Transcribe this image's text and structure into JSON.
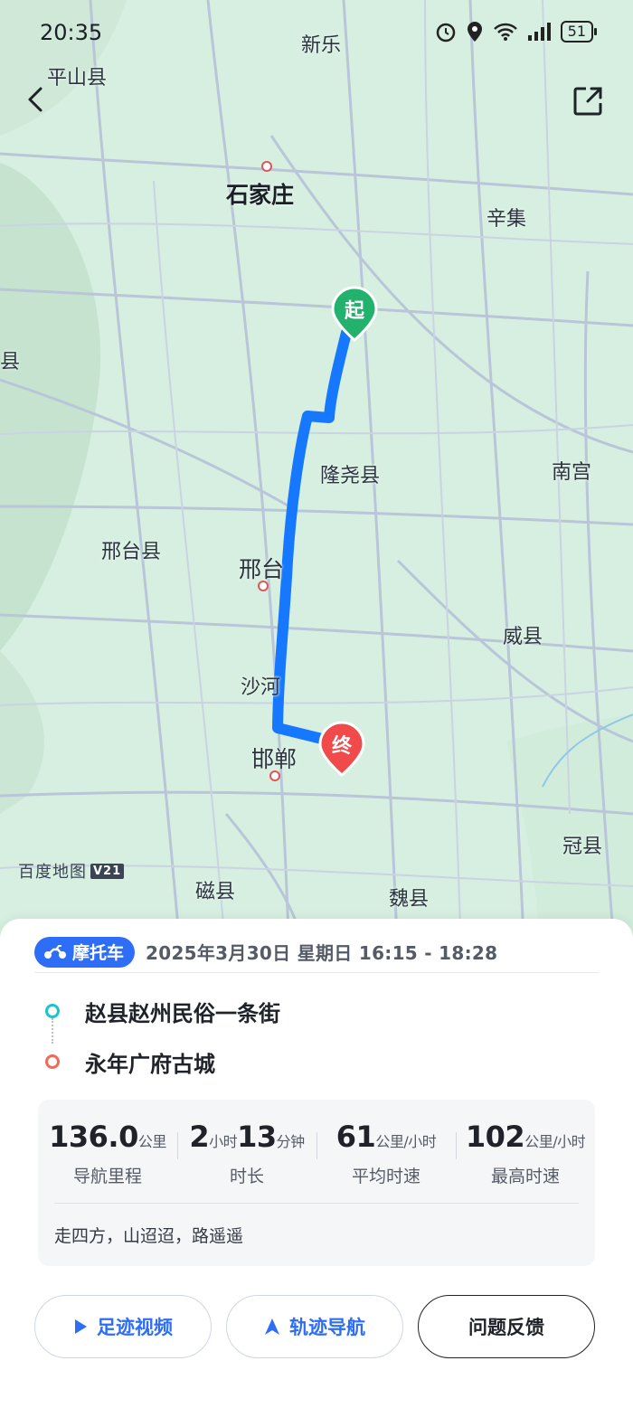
{
  "status_bar": {
    "time": "20:35",
    "battery": "51"
  },
  "map": {
    "labels": {
      "xinle": "新乐",
      "pingshan": "平山县",
      "shijiazhuang": "石家庄",
      "xinji": "辛集",
      "zhaoxian_partial": "赵县",
      "left_xian": "县",
      "longyao": "隆尧县",
      "nangong": "南宫",
      "xingtaixian": "邢台县",
      "xingtai": "邢台",
      "weixian": "威县",
      "shahe": "沙河",
      "handan": "邯郸",
      "guanxian": "冠县",
      "cixian": "磁县",
      "weixian2": "魏县",
      "left_edge": "县"
    },
    "start_marker": "起",
    "end_marker": "终",
    "logo": "百度地图",
    "logo_version": "V21"
  },
  "trip": {
    "mode": "摩托车",
    "datetime": "2025年3月30日 星期日 16:15 - 18:28",
    "start": "赵县赵州民俗一条街",
    "end": "永年广府古城"
  },
  "stats": {
    "distance_value": "136.0",
    "distance_unit": "公里",
    "distance_label": "导航里程",
    "dur_h": "2",
    "dur_h_unit": "小时",
    "dur_m": "13",
    "dur_m_unit": "分钟",
    "duration_label": "时长",
    "avg_value": "61",
    "avg_unit": "公里/小时",
    "avg_label": "平均时速",
    "max_value": "102",
    "max_unit": "公里/小时",
    "max_label": "最高时速",
    "slogan": "走四方，山迢迢，路遥遥"
  },
  "actions": {
    "video": "足迹视频",
    "navigate": "轨迹导航",
    "feedback": "问题反馈"
  },
  "colors": {
    "route": "#1677ff",
    "start": "#23b26d",
    "end": "#f04a4a",
    "accent": "#2e6ef7"
  }
}
